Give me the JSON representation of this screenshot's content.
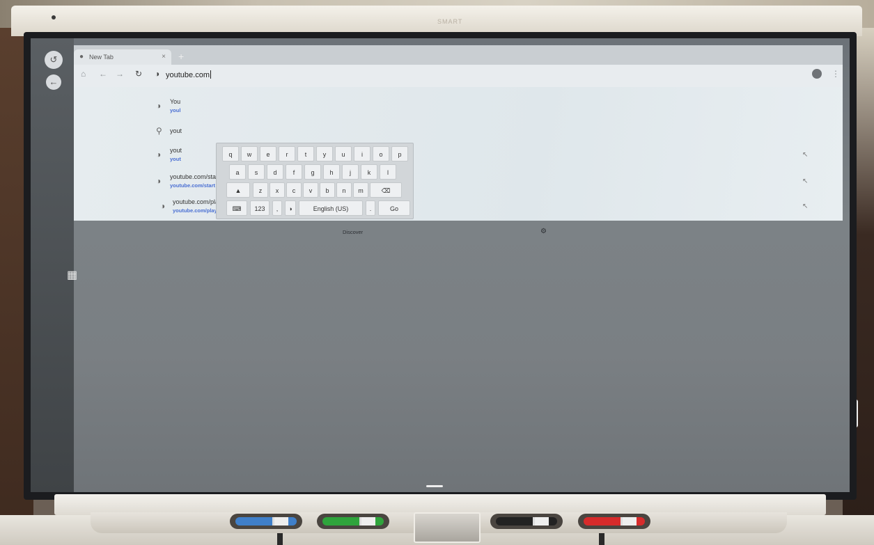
{
  "browser": {
    "tab": {
      "title": "New Tab"
    },
    "omnibox": {
      "value": "youtube.com"
    }
  },
  "suggestions": [
    {
      "main": "You",
      "url": "youl"
    },
    {
      "main": "yout",
      "url": ""
    },
    {
      "main": "yout",
      "url": "yout"
    },
    {
      "main": "youtube.com/start",
      "url": "youtube.com/start"
    },
    {
      "main": "youtube.com/play",
      "url": "youtube.com/play"
    }
  ],
  "keyboard": {
    "row1": [
      "q",
      "w",
      "e",
      "r",
      "t",
      "y",
      "u",
      "i",
      "o",
      "p"
    ],
    "row2": [
      "a",
      "s",
      "d",
      "f",
      "g",
      "h",
      "j",
      "k",
      "l"
    ],
    "row3": [
      "z",
      "x",
      "c",
      "v",
      "b",
      "n",
      "m"
    ],
    "numbers_label": "123",
    "comma_label": ",",
    "language_label": "English (US)",
    "period_label": ".",
    "go_label": "Go"
  },
  "discover": {
    "label": "Discover"
  },
  "pens": [
    {
      "color": "#3f7fc9"
    },
    {
      "color": "#2fa43c"
    },
    {
      "color": "#222222"
    },
    {
      "color": "#d72b2b"
    }
  ],
  "icons": {
    "back": "arrow-left-icon",
    "forward": "arrow-right-icon",
    "reload": "reload-icon",
    "site": "globe-icon",
    "search": "search-icon",
    "fill": "arrow-up-left-icon"
  }
}
